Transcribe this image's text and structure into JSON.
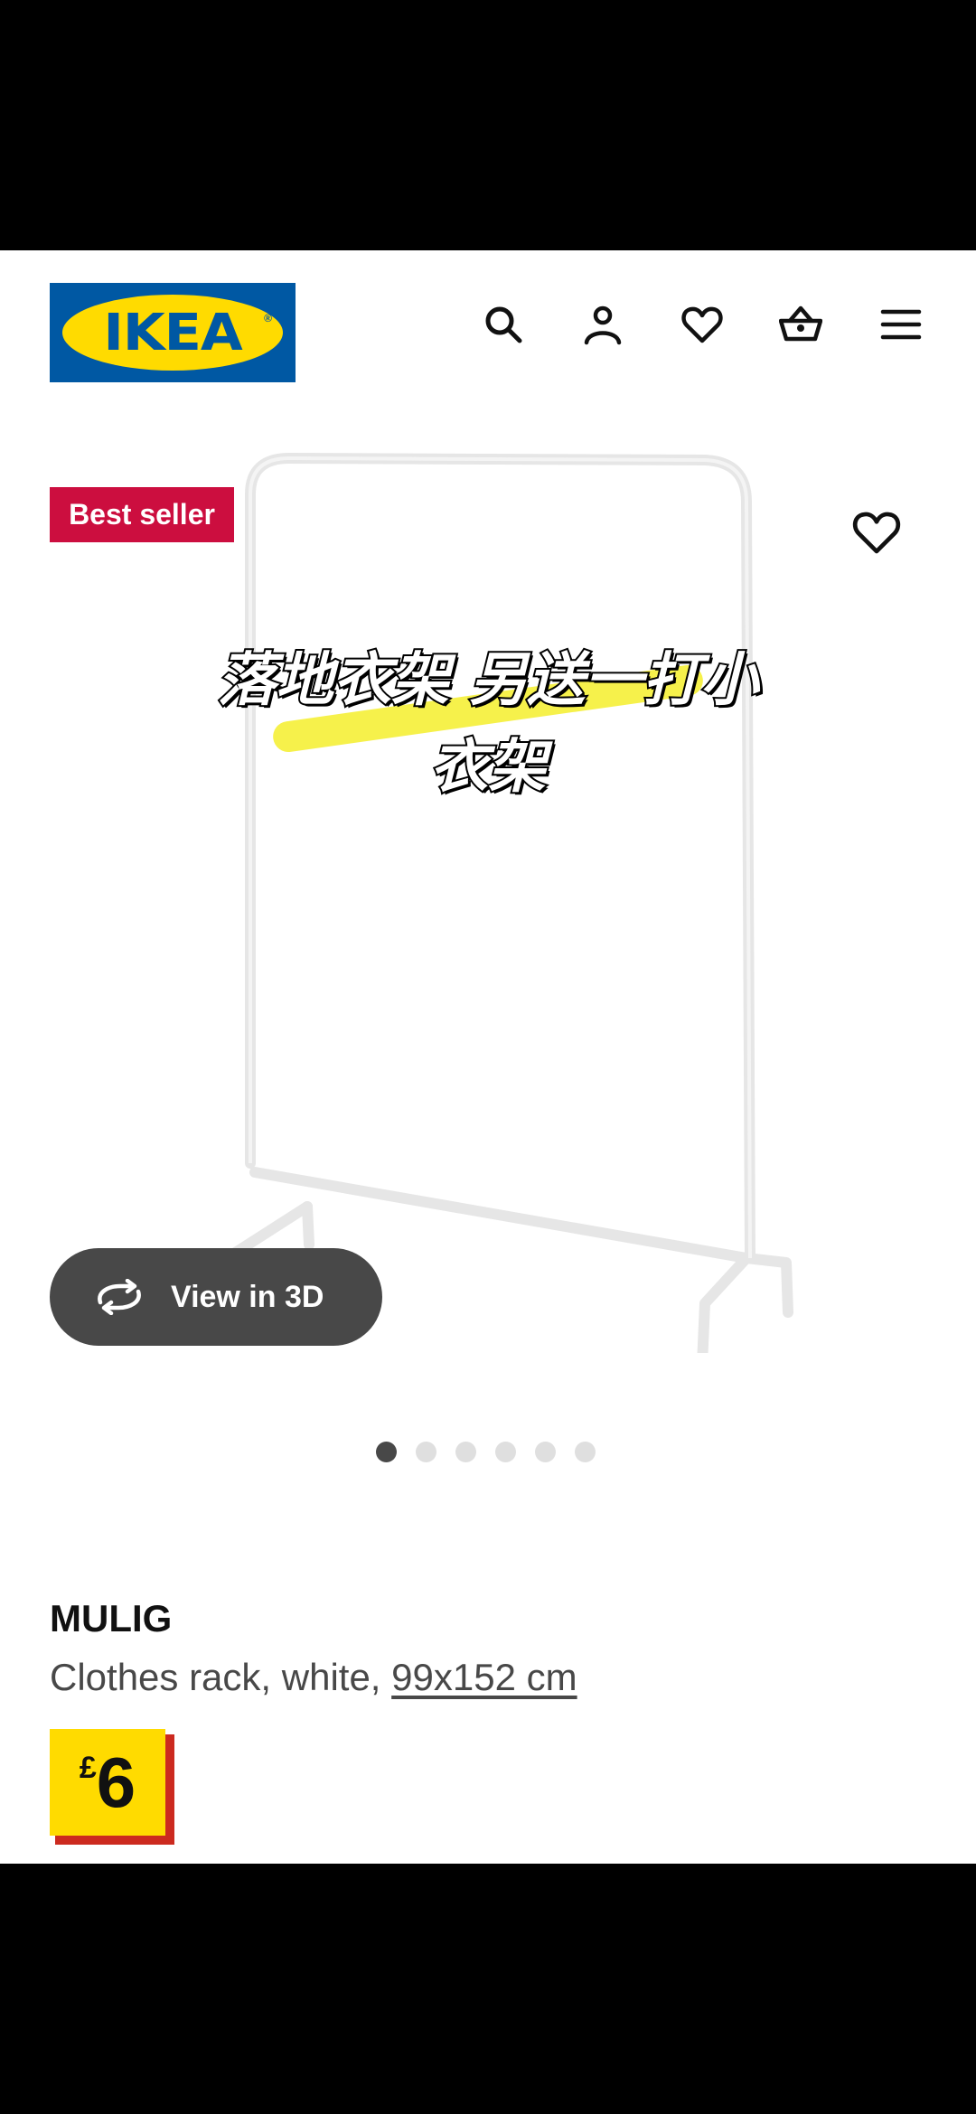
{
  "brand": {
    "logo_text": "IKEA",
    "colors": {
      "blue": "#0058a3",
      "yellow": "#ffdb00",
      "badge_red": "#cc0e3f"
    }
  },
  "header": {
    "icons": [
      "search-icon",
      "account-icon",
      "wishlist-heart-icon",
      "basket-icon",
      "menu-icon"
    ]
  },
  "hero": {
    "badge": "Best seller",
    "caption_line1": "落地衣架 另送一打小",
    "caption_line2": "衣架",
    "view3d_label": "View in 3D",
    "carousel": {
      "count": 6,
      "active": 1
    }
  },
  "product": {
    "name": "MULIG",
    "description_prefix": "Clothes rack, white, ",
    "dimensions": "99x152 cm",
    "price_currency": "£",
    "price_value": "6"
  }
}
